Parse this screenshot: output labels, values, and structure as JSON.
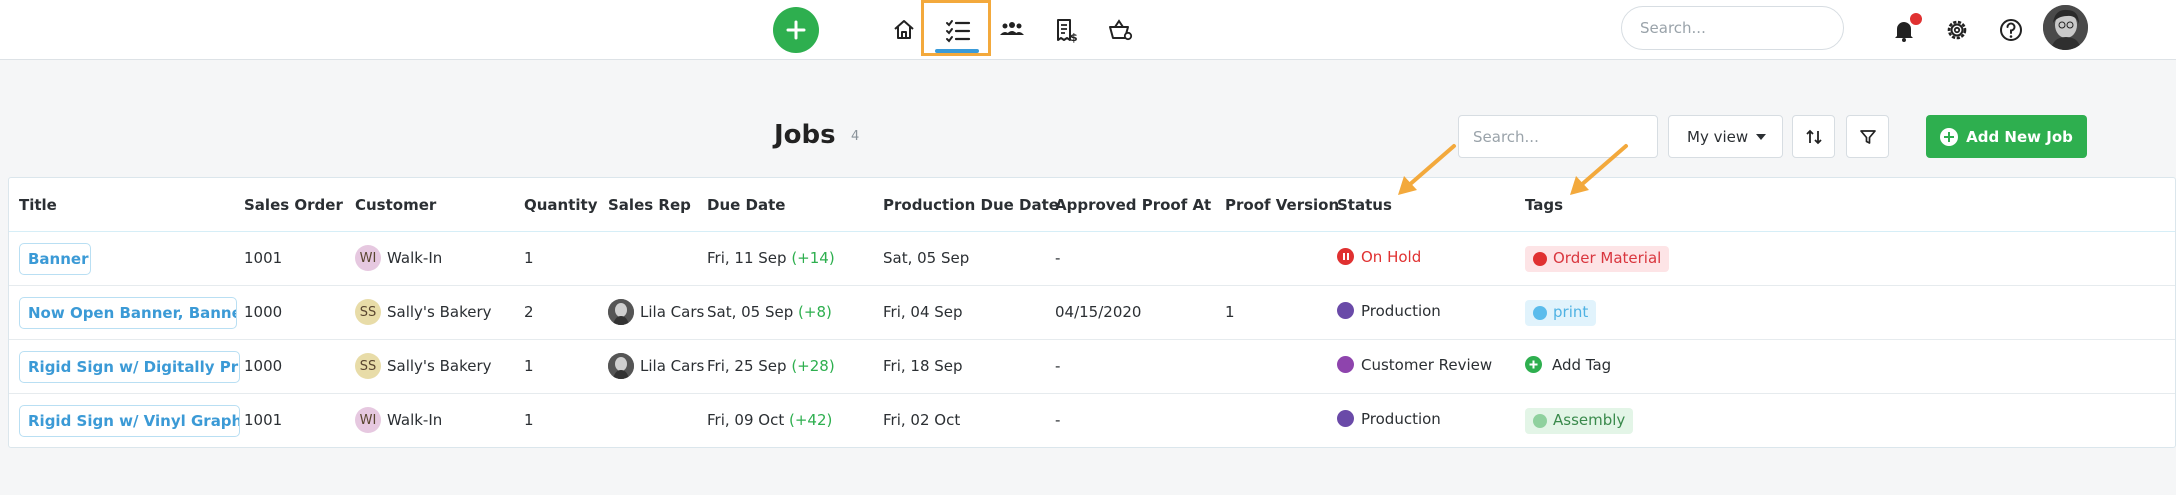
{
  "nav": {
    "add_icon": "plus-icon",
    "icons": [
      "home-icon",
      "tasks-list-icon",
      "people-icon",
      "invoice-icon",
      "basket-icon"
    ],
    "search_placeholder": "Search...",
    "accent": "#2eaf4f",
    "highlight": "#f3a93c"
  },
  "header": {
    "title": "Jobs",
    "count": "4",
    "search_placeholder": "Search...",
    "view_label": "My view",
    "add_job_label": "Add New Job"
  },
  "table": {
    "columns": [
      "Title",
      "Sales Order",
      "Customer",
      "Quantity",
      "Sales Rep",
      "Due Date",
      "Production Due Date",
      "Approved Proof At",
      "Proof Version",
      "Status",
      "Tags"
    ],
    "rows": [
      {
        "title": "Banner",
        "sales_order": "1001",
        "customer_initials": "WI",
        "customer": "Walk-In",
        "quantity": "1",
        "sales_rep": "",
        "due_date": "Fri, 11 Sep",
        "due_offset": "(+14)",
        "production_due": "Sat, 05 Sep",
        "approved_proof": "-",
        "proof_version": "",
        "status": "On Hold",
        "status_color": "#e03131",
        "tag": "Order Material",
        "tag_color": "#e03131"
      },
      {
        "title": "Now Open Banner, Banner",
        "sales_order": "1000",
        "customer_initials": "SS",
        "customer": "Sally's Bakery",
        "quantity": "2",
        "sales_rep": "Lila Cars",
        "due_date": "Sat, 05 Sep",
        "due_offset": "(+8)",
        "production_due": "Fri, 04 Sep",
        "approved_proof": "04/15/2020",
        "proof_version": "1",
        "status": "Production",
        "status_color": "#6a4aa8",
        "tag": "print",
        "tag_color": "#5bbcec"
      },
      {
        "title": "Rigid Sign w/ Digitally Print",
        "sales_order": "1000",
        "customer_initials": "SS",
        "customer": "Sally's Bakery",
        "quantity": "1",
        "sales_rep": "Lila Cars",
        "due_date": "Fri, 25 Sep",
        "due_offset": "(+28)",
        "production_due": "Fri, 18 Sep",
        "approved_proof": "-",
        "proof_version": "",
        "status": "Customer Review",
        "status_color": "#8e44ad",
        "tag": "Add Tag",
        "tag_color": "#2eaf4f"
      },
      {
        "title": "Rigid Sign w/ Vinyl Graphics",
        "sales_order": "1001",
        "customer_initials": "WI",
        "customer": "Walk-In",
        "quantity": "1",
        "sales_rep": "",
        "due_date": "Fri, 09 Oct",
        "due_offset": "(+42)",
        "production_due": "Fri, 02 Oct",
        "approved_proof": "-",
        "proof_version": "",
        "status": "Production",
        "status_color": "#6a4aa8",
        "tag": "Assembly",
        "tag_color": "#8fd19e"
      }
    ]
  }
}
